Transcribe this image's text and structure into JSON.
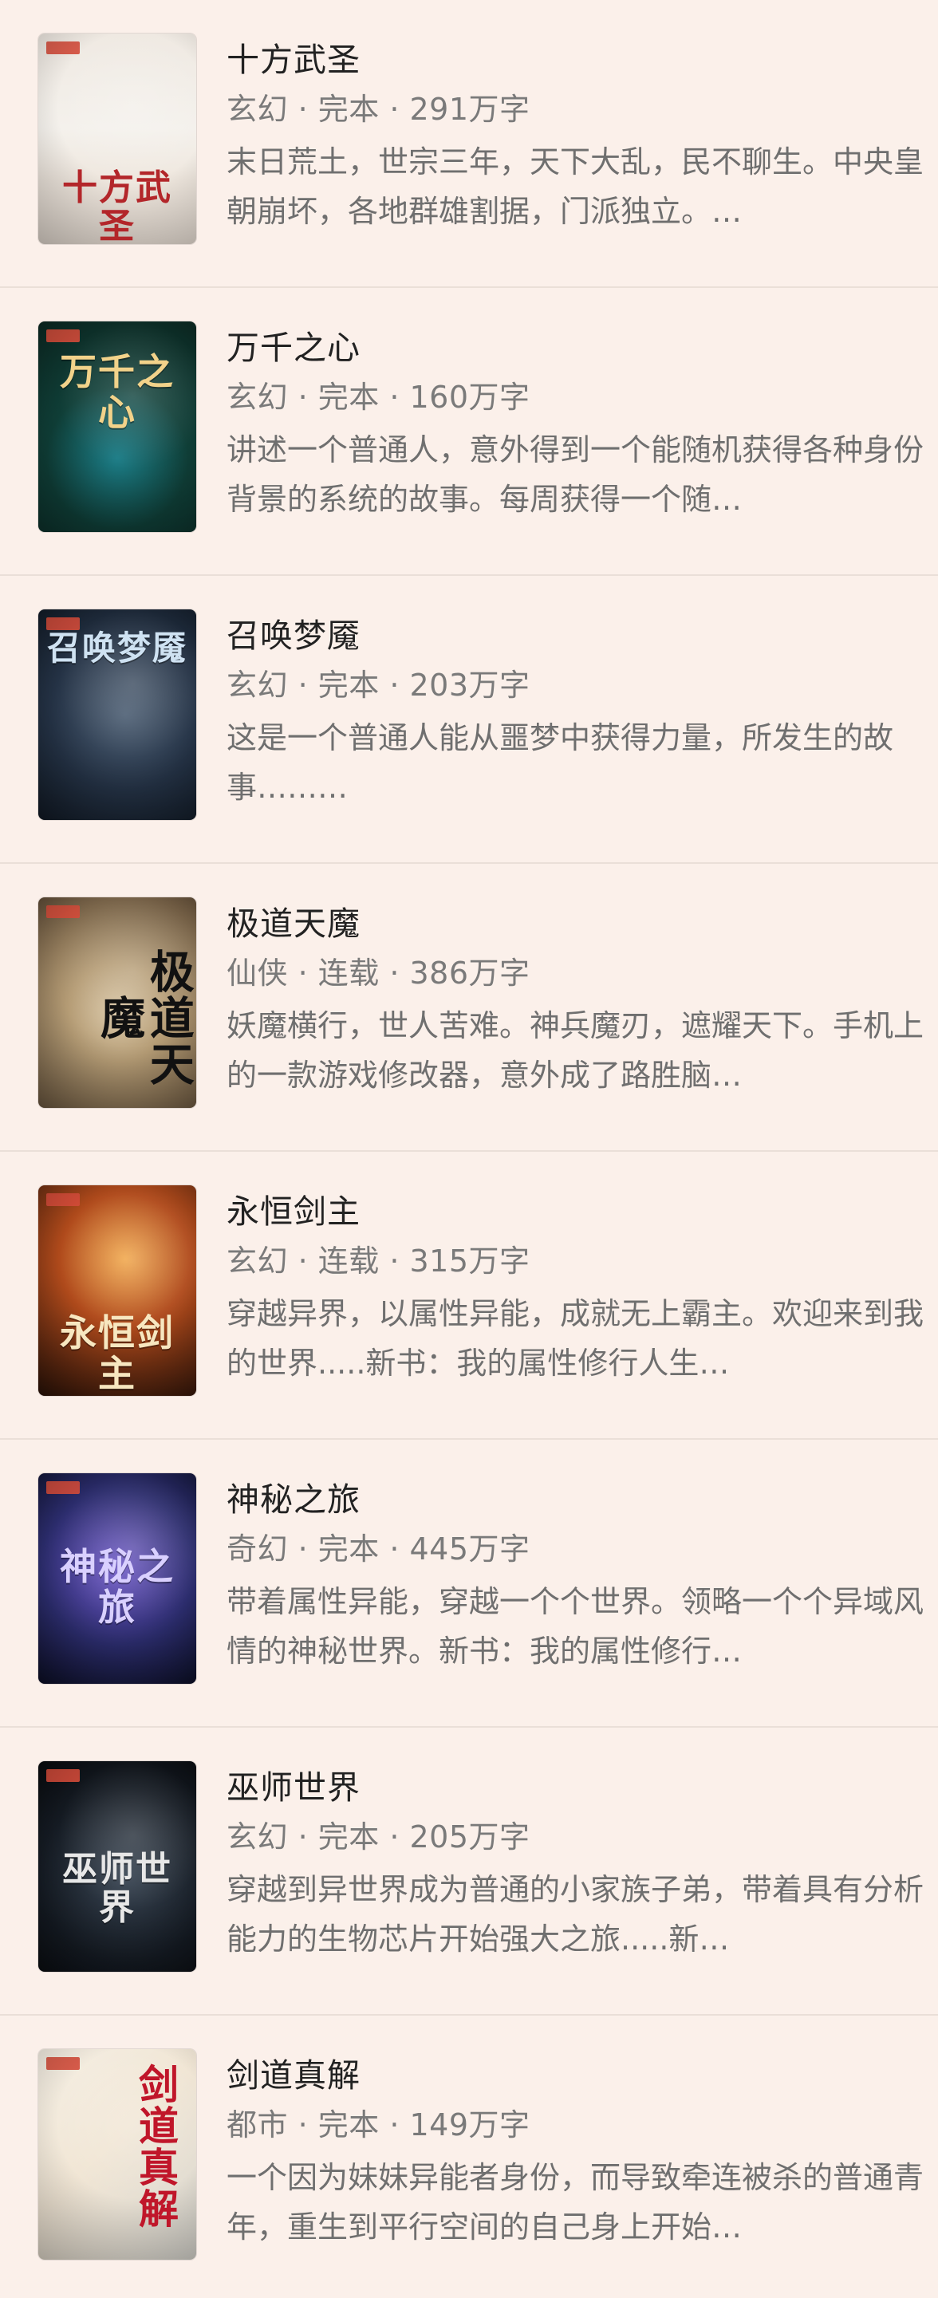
{
  "books": [
    {
      "title": "十方武圣",
      "meta": "玄幻 · 完本 · 291万字",
      "desc": "末日荒土，世宗三年，天下大乱，民不聊生。中央皇朝崩坏，各地群雄割据，门派独立。…",
      "cover_text": "十方武圣",
      "cover_style": "c1"
    },
    {
      "title": "万千之心",
      "meta": "玄幻 · 完本 · 160万字",
      "desc": "讲述一个普通人，意外得到一个能随机获得各种身份背景的系统的故事。每周获得一个随…",
      "cover_text": "万千之心",
      "cover_style": "c2"
    },
    {
      "title": "召唤梦魇",
      "meta": "玄幻 · 完本 · 203万字",
      "desc": "这是一个普通人能从噩梦中获得力量，所发生的故事………",
      "cover_text": "召唤梦魇",
      "cover_style": "c3"
    },
    {
      "title": "极道天魔",
      "meta": "仙侠 · 连载 · 386万字",
      "desc": "妖魔横行，世人苦难。神兵魔刃，遮耀天下。手机上的一款游戏修改器，意外成了路胜脑…",
      "cover_text": "极道天魔",
      "cover_style": "c4"
    },
    {
      "title": "永恒剑主",
      "meta": "玄幻 · 连载 · 315万字",
      "desc": "穿越异界，以属性异能，成就无上霸主。欢迎来到我的世界.....新书：我的属性修行人生…",
      "cover_text": "永恒剑主",
      "cover_style": "c5"
    },
    {
      "title": "神秘之旅",
      "meta": "奇幻 · 完本 · 445万字",
      "desc": "带着属性异能，穿越一个个世界。领略一个个异域风情的神秘世界。新书：我的属性修行…",
      "cover_text": "神秘之旅",
      "cover_style": "c6"
    },
    {
      "title": "巫师世界",
      "meta": "玄幻 · 完本 · 205万字",
      "desc": "穿越到异世界成为普通的小家族子弟，带着具有分析能力的生物芯片开始强大之旅.....新…",
      "cover_text": "巫师世界",
      "cover_style": "c7"
    },
    {
      "title": "剑道真解",
      "meta": "都市 · 完本 · 149万字",
      "desc": "一个因为妹妹异能者身份，而导致牵连被杀的普通青年，重生到平行空间的自己身上开始…",
      "cover_text": "剑道真解",
      "cover_style": "c8"
    }
  ]
}
